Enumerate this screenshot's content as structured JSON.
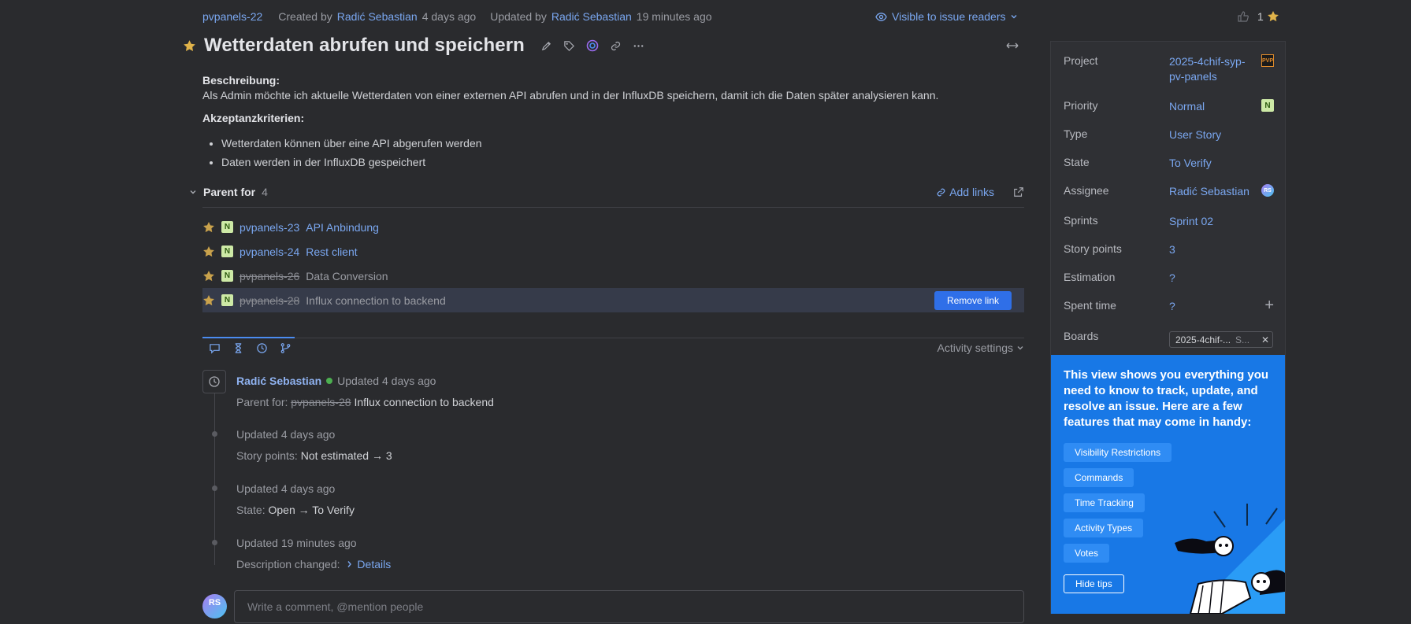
{
  "meta": {
    "issue_id": "pvpanels-22",
    "created_prefix": "Created by",
    "created_by": "Radić Sebastian",
    "created_ago": "4 days ago",
    "updated_prefix": "Updated by",
    "updated_by": "Radić Sebastian",
    "updated_ago": "19 minutes ago",
    "visibility": "Visible to issue readers",
    "vote_count": "1"
  },
  "title": "Wetterdaten abrufen und speichern",
  "description": {
    "heading1": "Beschreibung:",
    "text": "Als Admin möchte ich aktuelle Wetterdaten von einer externen API abrufen und in der InfluxDB speichern, damit ich die Daten später analysieren kann.",
    "heading2": "Akzeptanzkriterien:",
    "bullets": [
      "Wetterdaten können über eine API abgerufen werden",
      "Daten werden in der InfluxDB gespeichert"
    ]
  },
  "parent_for": {
    "label": "Parent for",
    "count": "4",
    "add_links": "Add links",
    "remove_link": "Remove link",
    "badge": "N",
    "items": [
      {
        "id": "pvpanels-23",
        "summary": "API Anbindung",
        "resolved": false
      },
      {
        "id": "pvpanels-24",
        "summary": "Rest client",
        "resolved": false
      },
      {
        "id": "pvpanels-26",
        "summary": "Data Conversion",
        "resolved": true
      },
      {
        "id": "pvpanels-28",
        "summary": "Influx connection to backend",
        "resolved": true
      }
    ]
  },
  "activity": {
    "settings": "Activity settings",
    "author": "Radić Sebastian",
    "entries": [
      {
        "head": "Updated 4 days ago",
        "prefix": "Parent for:",
        "id": "pvpanels-28",
        "value": "Influx connection to backend"
      },
      {
        "head": "Updated 4 days ago",
        "prefix": "Story points:",
        "value": "Not estimated → 3"
      },
      {
        "head": "Updated 4 days ago",
        "prefix": "State:",
        "value": "Open → To Verify"
      },
      {
        "head": "Updated 19 minutes ago",
        "prefix": "Description changed:",
        "value": "Details"
      }
    ]
  },
  "comment": {
    "avatar": "RS",
    "placeholder": "Write a comment, @mention people"
  },
  "panel": {
    "fields": [
      {
        "label": "Project",
        "value": "2025-4chif-syp-pv-panels"
      },
      {
        "label": "Priority",
        "value": "Normal"
      },
      {
        "label": "Type",
        "value": "User Story"
      },
      {
        "label": "State",
        "value": "To Verify"
      },
      {
        "label": "Assignee",
        "value": "Radić Sebastian"
      },
      {
        "label": "Sprints",
        "value": "Sprint 02"
      },
      {
        "label": "Story points",
        "value": "3"
      },
      {
        "label": "Estimation",
        "value": "?"
      },
      {
        "label": "Spent time",
        "value": "?"
      },
      {
        "label": "Boards",
        "value": "2025-4chif-..."
      }
    ],
    "project_line1": "2025-4chif-syp-",
    "project_line2": "pv-panels",
    "project_icon": "PVP",
    "priority_badge": "N",
    "assignee_avatar": "RS",
    "board_chip": "2025-4chif-...",
    "board_chip_small": "S..."
  },
  "tips": {
    "text": "This view shows you everything you need to know to track, update, and resolve an issue. Here are a few features that may come in handy:",
    "buttons": [
      "Visibility Restrictions",
      "Commands",
      "Time Tracking",
      "Activity Types",
      "Votes"
    ],
    "hide": "Hide tips"
  },
  "colors": {
    "accent": "#7aa7f0",
    "background": "#2a2b2e",
    "tips_bg": "#1878e6",
    "star": "#e0b34a",
    "primary_button": "#2f6fe8"
  }
}
